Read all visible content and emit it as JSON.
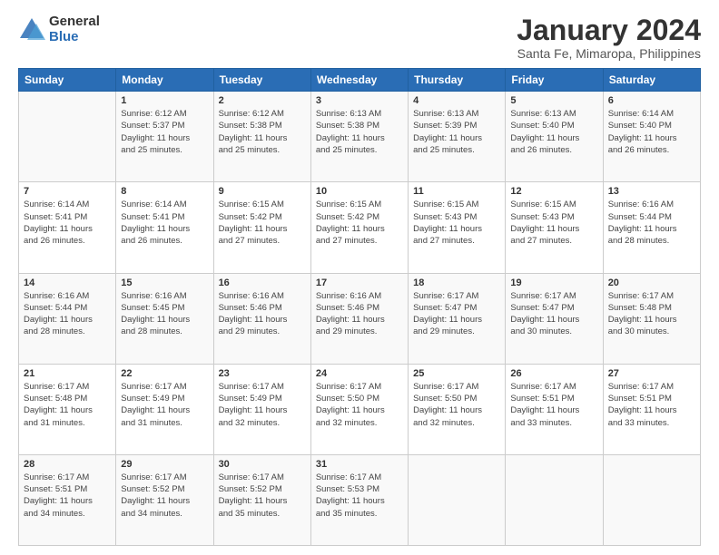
{
  "logo": {
    "general": "General",
    "blue": "Blue"
  },
  "header": {
    "title": "January 2024",
    "subtitle": "Santa Fe, Mimaropa, Philippines"
  },
  "weekdays": [
    "Sunday",
    "Monday",
    "Tuesday",
    "Wednesday",
    "Thursday",
    "Friday",
    "Saturday"
  ],
  "weeks": [
    [
      {
        "day": "",
        "info": ""
      },
      {
        "day": "1",
        "info": "Sunrise: 6:12 AM\nSunset: 5:37 PM\nDaylight: 11 hours\nand 25 minutes."
      },
      {
        "day": "2",
        "info": "Sunrise: 6:12 AM\nSunset: 5:38 PM\nDaylight: 11 hours\nand 25 minutes."
      },
      {
        "day": "3",
        "info": "Sunrise: 6:13 AM\nSunset: 5:38 PM\nDaylight: 11 hours\nand 25 minutes."
      },
      {
        "day": "4",
        "info": "Sunrise: 6:13 AM\nSunset: 5:39 PM\nDaylight: 11 hours\nand 25 minutes."
      },
      {
        "day": "5",
        "info": "Sunrise: 6:13 AM\nSunset: 5:40 PM\nDaylight: 11 hours\nand 26 minutes."
      },
      {
        "day": "6",
        "info": "Sunrise: 6:14 AM\nSunset: 5:40 PM\nDaylight: 11 hours\nand 26 minutes."
      }
    ],
    [
      {
        "day": "7",
        "info": "Sunrise: 6:14 AM\nSunset: 5:41 PM\nDaylight: 11 hours\nand 26 minutes."
      },
      {
        "day": "8",
        "info": "Sunrise: 6:14 AM\nSunset: 5:41 PM\nDaylight: 11 hours\nand 26 minutes."
      },
      {
        "day": "9",
        "info": "Sunrise: 6:15 AM\nSunset: 5:42 PM\nDaylight: 11 hours\nand 27 minutes."
      },
      {
        "day": "10",
        "info": "Sunrise: 6:15 AM\nSunset: 5:42 PM\nDaylight: 11 hours\nand 27 minutes."
      },
      {
        "day": "11",
        "info": "Sunrise: 6:15 AM\nSunset: 5:43 PM\nDaylight: 11 hours\nand 27 minutes."
      },
      {
        "day": "12",
        "info": "Sunrise: 6:15 AM\nSunset: 5:43 PM\nDaylight: 11 hours\nand 27 minutes."
      },
      {
        "day": "13",
        "info": "Sunrise: 6:16 AM\nSunset: 5:44 PM\nDaylight: 11 hours\nand 28 minutes."
      }
    ],
    [
      {
        "day": "14",
        "info": "Sunrise: 6:16 AM\nSunset: 5:44 PM\nDaylight: 11 hours\nand 28 minutes."
      },
      {
        "day": "15",
        "info": "Sunrise: 6:16 AM\nSunset: 5:45 PM\nDaylight: 11 hours\nand 28 minutes."
      },
      {
        "day": "16",
        "info": "Sunrise: 6:16 AM\nSunset: 5:46 PM\nDaylight: 11 hours\nand 29 minutes."
      },
      {
        "day": "17",
        "info": "Sunrise: 6:16 AM\nSunset: 5:46 PM\nDaylight: 11 hours\nand 29 minutes."
      },
      {
        "day": "18",
        "info": "Sunrise: 6:17 AM\nSunset: 5:47 PM\nDaylight: 11 hours\nand 29 minutes."
      },
      {
        "day": "19",
        "info": "Sunrise: 6:17 AM\nSunset: 5:47 PM\nDaylight: 11 hours\nand 30 minutes."
      },
      {
        "day": "20",
        "info": "Sunrise: 6:17 AM\nSunset: 5:48 PM\nDaylight: 11 hours\nand 30 minutes."
      }
    ],
    [
      {
        "day": "21",
        "info": "Sunrise: 6:17 AM\nSunset: 5:48 PM\nDaylight: 11 hours\nand 31 minutes."
      },
      {
        "day": "22",
        "info": "Sunrise: 6:17 AM\nSunset: 5:49 PM\nDaylight: 11 hours\nand 31 minutes."
      },
      {
        "day": "23",
        "info": "Sunrise: 6:17 AM\nSunset: 5:49 PM\nDaylight: 11 hours\nand 32 minutes."
      },
      {
        "day": "24",
        "info": "Sunrise: 6:17 AM\nSunset: 5:50 PM\nDaylight: 11 hours\nand 32 minutes."
      },
      {
        "day": "25",
        "info": "Sunrise: 6:17 AM\nSunset: 5:50 PM\nDaylight: 11 hours\nand 32 minutes."
      },
      {
        "day": "26",
        "info": "Sunrise: 6:17 AM\nSunset: 5:51 PM\nDaylight: 11 hours\nand 33 minutes."
      },
      {
        "day": "27",
        "info": "Sunrise: 6:17 AM\nSunset: 5:51 PM\nDaylight: 11 hours\nand 33 minutes."
      }
    ],
    [
      {
        "day": "28",
        "info": "Sunrise: 6:17 AM\nSunset: 5:51 PM\nDaylight: 11 hours\nand 34 minutes."
      },
      {
        "day": "29",
        "info": "Sunrise: 6:17 AM\nSunset: 5:52 PM\nDaylight: 11 hours\nand 34 minutes."
      },
      {
        "day": "30",
        "info": "Sunrise: 6:17 AM\nSunset: 5:52 PM\nDaylight: 11 hours\nand 35 minutes."
      },
      {
        "day": "31",
        "info": "Sunrise: 6:17 AM\nSunset: 5:53 PM\nDaylight: 11 hours\nand 35 minutes."
      },
      {
        "day": "",
        "info": ""
      },
      {
        "day": "",
        "info": ""
      },
      {
        "day": "",
        "info": ""
      }
    ]
  ]
}
